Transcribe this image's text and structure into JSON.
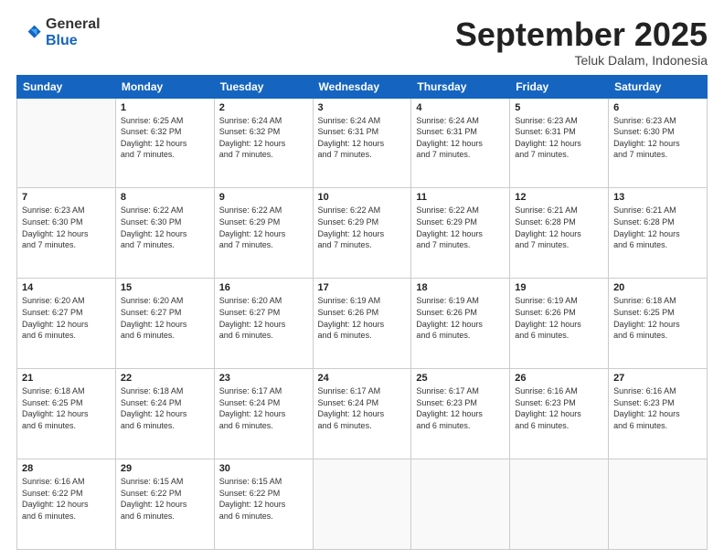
{
  "header": {
    "logo_general": "General",
    "logo_blue": "Blue",
    "month": "September 2025",
    "location": "Teluk Dalam, Indonesia"
  },
  "days_of_week": [
    "Sunday",
    "Monday",
    "Tuesday",
    "Wednesday",
    "Thursday",
    "Friday",
    "Saturday"
  ],
  "weeks": [
    [
      {
        "day": "",
        "info": ""
      },
      {
        "day": "1",
        "info": "Sunrise: 6:25 AM\nSunset: 6:32 PM\nDaylight: 12 hours\nand 7 minutes."
      },
      {
        "day": "2",
        "info": "Sunrise: 6:24 AM\nSunset: 6:32 PM\nDaylight: 12 hours\nand 7 minutes."
      },
      {
        "day": "3",
        "info": "Sunrise: 6:24 AM\nSunset: 6:31 PM\nDaylight: 12 hours\nand 7 minutes."
      },
      {
        "day": "4",
        "info": "Sunrise: 6:24 AM\nSunset: 6:31 PM\nDaylight: 12 hours\nand 7 minutes."
      },
      {
        "day": "5",
        "info": "Sunrise: 6:23 AM\nSunset: 6:31 PM\nDaylight: 12 hours\nand 7 minutes."
      },
      {
        "day": "6",
        "info": "Sunrise: 6:23 AM\nSunset: 6:30 PM\nDaylight: 12 hours\nand 7 minutes."
      }
    ],
    [
      {
        "day": "7",
        "info": "Sunrise: 6:23 AM\nSunset: 6:30 PM\nDaylight: 12 hours\nand 7 minutes."
      },
      {
        "day": "8",
        "info": "Sunrise: 6:22 AM\nSunset: 6:30 PM\nDaylight: 12 hours\nand 7 minutes."
      },
      {
        "day": "9",
        "info": "Sunrise: 6:22 AM\nSunset: 6:29 PM\nDaylight: 12 hours\nand 7 minutes."
      },
      {
        "day": "10",
        "info": "Sunrise: 6:22 AM\nSunset: 6:29 PM\nDaylight: 12 hours\nand 7 minutes."
      },
      {
        "day": "11",
        "info": "Sunrise: 6:22 AM\nSunset: 6:29 PM\nDaylight: 12 hours\nand 7 minutes."
      },
      {
        "day": "12",
        "info": "Sunrise: 6:21 AM\nSunset: 6:28 PM\nDaylight: 12 hours\nand 7 minutes."
      },
      {
        "day": "13",
        "info": "Sunrise: 6:21 AM\nSunset: 6:28 PM\nDaylight: 12 hours\nand 6 minutes."
      }
    ],
    [
      {
        "day": "14",
        "info": "Sunrise: 6:20 AM\nSunset: 6:27 PM\nDaylight: 12 hours\nand 6 minutes."
      },
      {
        "day": "15",
        "info": "Sunrise: 6:20 AM\nSunset: 6:27 PM\nDaylight: 12 hours\nand 6 minutes."
      },
      {
        "day": "16",
        "info": "Sunrise: 6:20 AM\nSunset: 6:27 PM\nDaylight: 12 hours\nand 6 minutes."
      },
      {
        "day": "17",
        "info": "Sunrise: 6:19 AM\nSunset: 6:26 PM\nDaylight: 12 hours\nand 6 minutes."
      },
      {
        "day": "18",
        "info": "Sunrise: 6:19 AM\nSunset: 6:26 PM\nDaylight: 12 hours\nand 6 minutes."
      },
      {
        "day": "19",
        "info": "Sunrise: 6:19 AM\nSunset: 6:26 PM\nDaylight: 12 hours\nand 6 minutes."
      },
      {
        "day": "20",
        "info": "Sunrise: 6:18 AM\nSunset: 6:25 PM\nDaylight: 12 hours\nand 6 minutes."
      }
    ],
    [
      {
        "day": "21",
        "info": "Sunrise: 6:18 AM\nSunset: 6:25 PM\nDaylight: 12 hours\nand 6 minutes."
      },
      {
        "day": "22",
        "info": "Sunrise: 6:18 AM\nSunset: 6:24 PM\nDaylight: 12 hours\nand 6 minutes."
      },
      {
        "day": "23",
        "info": "Sunrise: 6:17 AM\nSunset: 6:24 PM\nDaylight: 12 hours\nand 6 minutes."
      },
      {
        "day": "24",
        "info": "Sunrise: 6:17 AM\nSunset: 6:24 PM\nDaylight: 12 hours\nand 6 minutes."
      },
      {
        "day": "25",
        "info": "Sunrise: 6:17 AM\nSunset: 6:23 PM\nDaylight: 12 hours\nand 6 minutes."
      },
      {
        "day": "26",
        "info": "Sunrise: 6:16 AM\nSunset: 6:23 PM\nDaylight: 12 hours\nand 6 minutes."
      },
      {
        "day": "27",
        "info": "Sunrise: 6:16 AM\nSunset: 6:23 PM\nDaylight: 12 hours\nand 6 minutes."
      }
    ],
    [
      {
        "day": "28",
        "info": "Sunrise: 6:16 AM\nSunset: 6:22 PM\nDaylight: 12 hours\nand 6 minutes."
      },
      {
        "day": "29",
        "info": "Sunrise: 6:15 AM\nSunset: 6:22 PM\nDaylight: 12 hours\nand 6 minutes."
      },
      {
        "day": "30",
        "info": "Sunrise: 6:15 AM\nSunset: 6:22 PM\nDaylight: 12 hours\nand 6 minutes."
      },
      {
        "day": "",
        "info": ""
      },
      {
        "day": "",
        "info": ""
      },
      {
        "day": "",
        "info": ""
      },
      {
        "day": "",
        "info": ""
      }
    ]
  ]
}
